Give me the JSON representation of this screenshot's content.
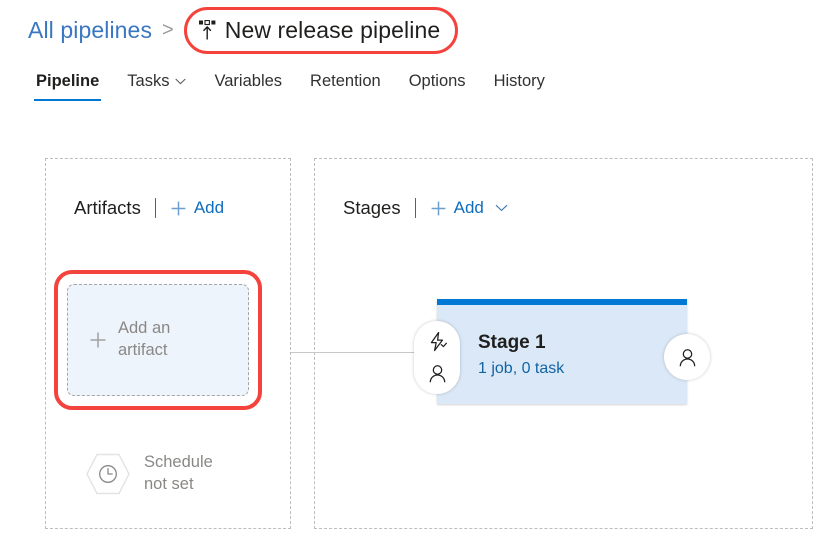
{
  "breadcrumb": {
    "root_label": "All pipelines",
    "separator": ">",
    "current_label": "New release pipeline",
    "current_icon": "release-pipeline-icon",
    "annotation_color": "#f4433c"
  },
  "tabs": [
    {
      "label": "Pipeline",
      "active": true,
      "caret": false
    },
    {
      "label": "Tasks",
      "active": false,
      "caret": true
    },
    {
      "label": "Variables",
      "active": false,
      "caret": false
    },
    {
      "label": "Retention",
      "active": false,
      "caret": false
    },
    {
      "label": "Options",
      "active": false,
      "caret": false
    },
    {
      "label": "History",
      "active": false,
      "caret": false
    }
  ],
  "artifacts": {
    "title": "Artifacts",
    "add_label": "Add",
    "add_icon": "plus-icon",
    "tile": {
      "label": "Add an artifact",
      "icon": "plus-icon",
      "fill_color": "#eef4fb"
    },
    "schedule": {
      "icon": "clock-hexagon-icon",
      "line1": "Schedule",
      "line2": "not set"
    }
  },
  "stages": {
    "title": "Stages",
    "add_label": "Add",
    "add_icon": "plus-icon",
    "add_caret_icon": "chevron-down-icon",
    "cards": [
      {
        "name": "Stage 1",
        "meta": "1 job, 0 task",
        "accent_color": "#0078d4",
        "body_color": "#dbe8f7",
        "pre_deployment_icons": [
          "lightning-bolt-icon",
          "person-icon"
        ],
        "post_deployment_icon": "person-icon"
      }
    ]
  },
  "colors": {
    "accent": "#0078d4",
    "link": "#0f6cbd",
    "annotation": "#f4433c",
    "muted_text": "#8a8886"
  }
}
